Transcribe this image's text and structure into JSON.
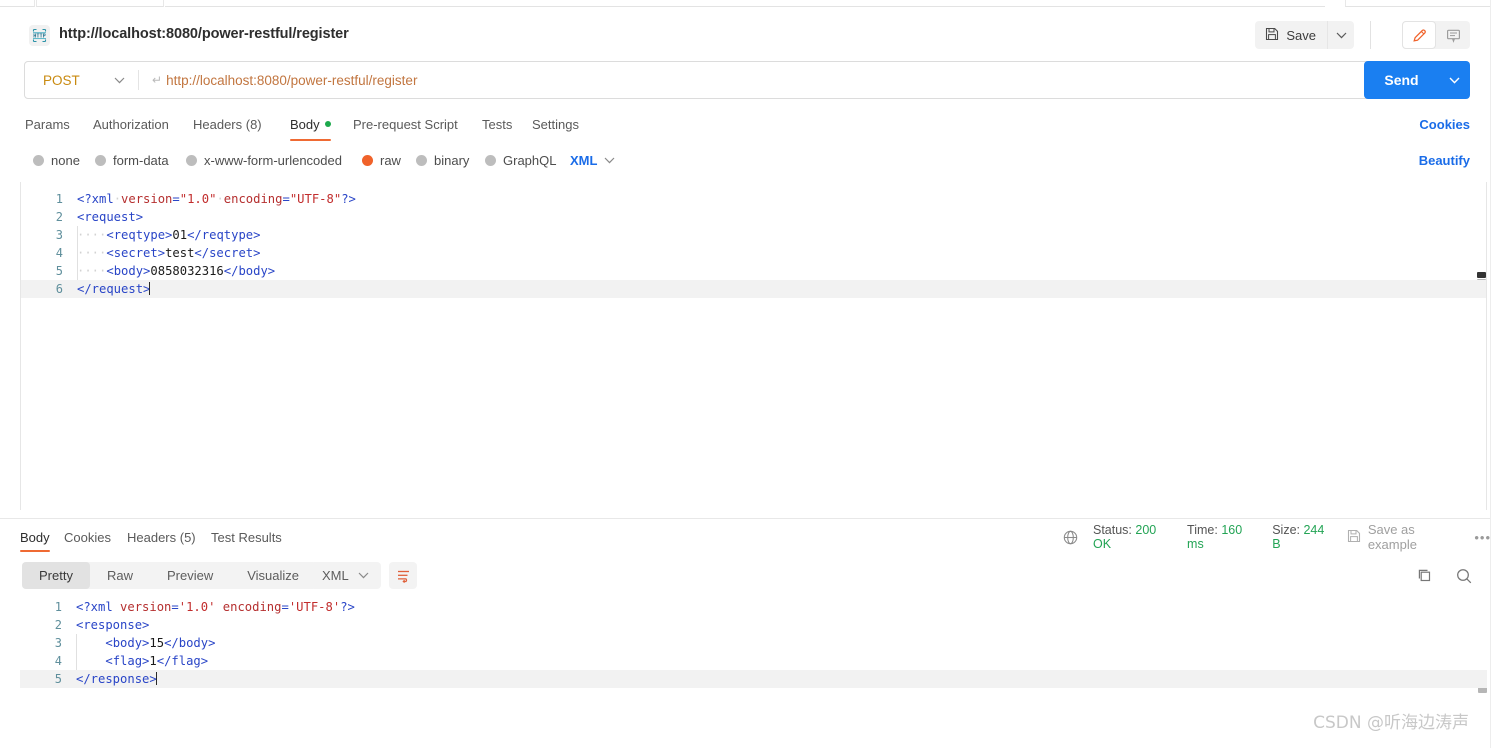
{
  "window": {
    "request_title": "http://localhost:8080/power-restful/register",
    "protocol_icon": "http-icon"
  },
  "toolbar": {
    "save_label": "Save",
    "save_caret_icon": "chevron-down-icon",
    "pencil_icon": "pencil-icon",
    "comment_icon": "comment-icon"
  },
  "url_bar": {
    "method": "POST",
    "method_caret_icon": "chevron-down-icon",
    "url": "http://localhost:8080/power-restful/register",
    "url_prefix_glyph": "↵",
    "send_label": "Send",
    "send_caret_icon": "chevron-down-icon"
  },
  "request_tabs": {
    "items": [
      {
        "label": "Params",
        "selected": false,
        "dot": false
      },
      {
        "label": "Authorization",
        "selected": false,
        "dot": false
      },
      {
        "label": "Headers (8)",
        "selected": false,
        "dot": false
      },
      {
        "label": "Body",
        "selected": true,
        "dot": true
      },
      {
        "label": "Pre-request Script",
        "selected": false,
        "dot": false
      },
      {
        "label": "Tests",
        "selected": false,
        "dot": false
      },
      {
        "label": "Settings",
        "selected": false,
        "dot": false
      }
    ],
    "cookies_link": "Cookies"
  },
  "body_types": {
    "options": [
      {
        "label": "none",
        "selected": false
      },
      {
        "label": "form-data",
        "selected": false
      },
      {
        "label": "x-www-form-urlencoded",
        "selected": false
      },
      {
        "label": "raw",
        "selected": true
      },
      {
        "label": "binary",
        "selected": false
      },
      {
        "label": "GraphQL",
        "selected": false
      }
    ],
    "format": "XML",
    "format_caret_icon": "chevron-down-icon",
    "beautify_label": "Beautify"
  },
  "request_body": {
    "language": "xml",
    "lines": [
      {
        "n": "1",
        "tokens": [
          {
            "t": "<?xml",
            "c": "tag"
          },
          {
            "t": "·",
            "c": "ws"
          },
          {
            "t": "version",
            "c": "attr"
          },
          {
            "t": "=",
            "c": "tag"
          },
          {
            "t": "\"1.0\"",
            "c": "str"
          },
          {
            "t": "·",
            "c": "ws"
          },
          {
            "t": "encoding",
            "c": "attr"
          },
          {
            "t": "=",
            "c": "tag"
          },
          {
            "t": "\"UTF-8\"",
            "c": "str"
          },
          {
            "t": "?>",
            "c": "tag"
          }
        ]
      },
      {
        "n": "2",
        "tokens": [
          {
            "t": "<request>",
            "c": "tag"
          }
        ]
      },
      {
        "n": "3",
        "tokens": [
          {
            "t": "····",
            "c": "ws"
          },
          {
            "t": "<reqtype>",
            "c": "tag"
          },
          {
            "t": "01",
            "c": "txt"
          },
          {
            "t": "</reqtype>",
            "c": "tag"
          }
        ]
      },
      {
        "n": "4",
        "tokens": [
          {
            "t": "····",
            "c": "ws"
          },
          {
            "t": "<secret>",
            "c": "tag"
          },
          {
            "t": "test",
            "c": "txt"
          },
          {
            "t": "</secret>",
            "c": "tag"
          }
        ]
      },
      {
        "n": "5",
        "tokens": [
          {
            "t": "····",
            "c": "ws"
          },
          {
            "t": "<body>",
            "c": "tag"
          },
          {
            "t": "0858032316",
            "c": "txt"
          },
          {
            "t": "</body>",
            "c": "tag"
          }
        ]
      },
      {
        "n": "6",
        "tokens": [
          {
            "t": "</request>",
            "c": "tag"
          }
        ],
        "cursor": true
      }
    ]
  },
  "response_tabs": {
    "items": [
      {
        "label": "Body",
        "selected": true
      },
      {
        "label": "Cookies",
        "selected": false
      },
      {
        "label": "Headers (5)",
        "selected": false
      },
      {
        "label": "Test Results",
        "selected": false
      }
    ]
  },
  "response_meta": {
    "globe_icon": "globe-icon",
    "status_key": "Status:",
    "status_value": "200 OK",
    "time_key": "Time:",
    "time_value": "160 ms",
    "size_key": "Size:",
    "size_value": "244 B",
    "save_example_label": "Save as example",
    "save_example_icon": "save-icon",
    "more_icon": "ellipsis-icon"
  },
  "response_toolbar": {
    "views": [
      {
        "label": "Pretty",
        "selected": true
      },
      {
        "label": "Raw",
        "selected": false
      },
      {
        "label": "Preview",
        "selected": false
      },
      {
        "label": "Visualize",
        "selected": false
      }
    ],
    "format": "XML",
    "format_caret_icon": "chevron-down-icon",
    "wrap_icon": "wrap-lines-icon",
    "copy_icon": "copy-icon",
    "search_icon": "search-icon"
  },
  "response_body": {
    "language": "xml",
    "lines": [
      {
        "n": "1",
        "tokens": [
          {
            "t": "<?xml",
            "c": "tag"
          },
          {
            "t": " ",
            "c": "ws"
          },
          {
            "t": "version",
            "c": "attr"
          },
          {
            "t": "=",
            "c": "tag"
          },
          {
            "t": "'1.0'",
            "c": "str"
          },
          {
            "t": " ",
            "c": "ws"
          },
          {
            "t": "encoding",
            "c": "attr"
          },
          {
            "t": "=",
            "c": "tag"
          },
          {
            "t": "'UTF-8'",
            "c": "str"
          },
          {
            "t": "?>",
            "c": "tag"
          }
        ]
      },
      {
        "n": "2",
        "tokens": [
          {
            "t": "<response>",
            "c": "tag"
          }
        ]
      },
      {
        "n": "3",
        "tokens": [
          {
            "t": "    ",
            "c": "ws"
          },
          {
            "t": "<body>",
            "c": "tag"
          },
          {
            "t": "15",
            "c": "txt"
          },
          {
            "t": "</body>",
            "c": "tag"
          }
        ]
      },
      {
        "n": "4",
        "tokens": [
          {
            "t": "    ",
            "c": "ws"
          },
          {
            "t": "<flag>",
            "c": "tag"
          },
          {
            "t": "1",
            "c": "txt"
          },
          {
            "t": "</flag>",
            "c": "tag"
          }
        ]
      },
      {
        "n": "5",
        "tokens": [
          {
            "t": "</response>",
            "c": "tag"
          }
        ],
        "cursor": true
      }
    ]
  },
  "watermark": {
    "text": "CSDN @听海边涛声"
  },
  "colors": {
    "accent_orange": "#ef6a33",
    "link_blue": "#1a6ce8",
    "send_blue": "#1a7ff1",
    "status_green": "#23a455",
    "method_orange": "#c98a10"
  }
}
